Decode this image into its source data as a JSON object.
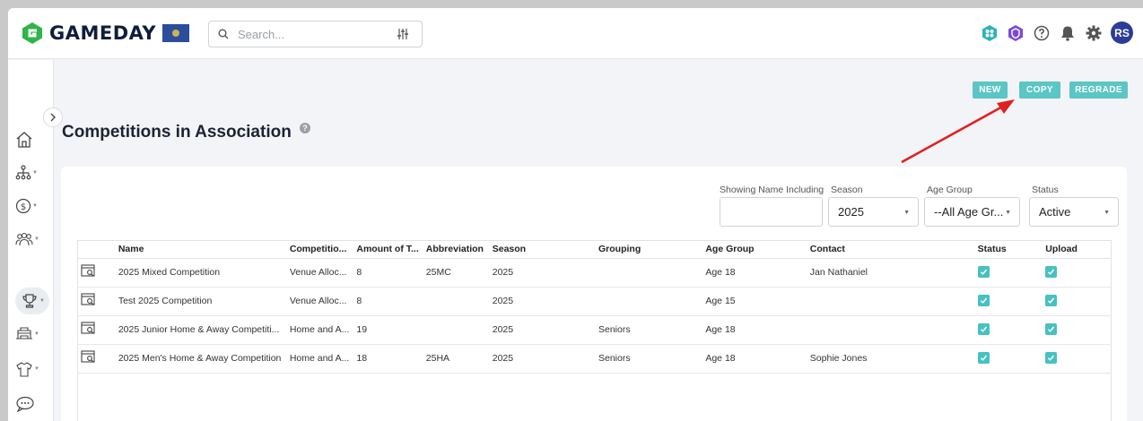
{
  "header": {
    "brand": "GAMEDAY",
    "search_placeholder": "Search...",
    "avatar_initials": "RS"
  },
  "actions": {
    "new": "NEW",
    "copy": "COPY",
    "regrade": "REGRADE"
  },
  "page": {
    "title": "Competitions in Association"
  },
  "filters": {
    "name_label": "Showing Name Including",
    "name_value": "",
    "season_label": "Season",
    "season_value": "2025",
    "age_label": "Age Group",
    "age_value": "--All Age Gr...",
    "status_label": "Status",
    "status_value": "Active"
  },
  "table": {
    "columns": [
      "Name",
      "Competitio...",
      "Amount of T...",
      "Abbreviation",
      "Season",
      "Grouping",
      "Age Group",
      "Contact",
      "Status",
      "Upload"
    ],
    "rows": [
      [
        "2025 Mixed Competition",
        "Venue Alloc...",
        "8",
        "25MC",
        "2025",
        "",
        "Age 18",
        "Jan Nathaniel"
      ],
      [
        "Test 2025 Competition",
        "Venue Alloc...",
        "8",
        "",
        "2025",
        "",
        "Age 15",
        ""
      ],
      [
        "2025 Junior Home & Away Competiti...",
        "Home and A...",
        "19",
        "",
        "2025",
        "Seniors",
        "Age 18",
        ""
      ],
      [
        "2025 Men's Home & Away Competition",
        "Home and A...",
        "18",
        "25HA",
        "2025",
        "Seniors",
        "Age 18",
        "Sophie Jones"
      ]
    ]
  },
  "colors": {
    "accent": "#5cc5c5",
    "check": "#47c1c1",
    "annotation_arrow": "#e02020",
    "brand_green": "#2fb44a"
  }
}
